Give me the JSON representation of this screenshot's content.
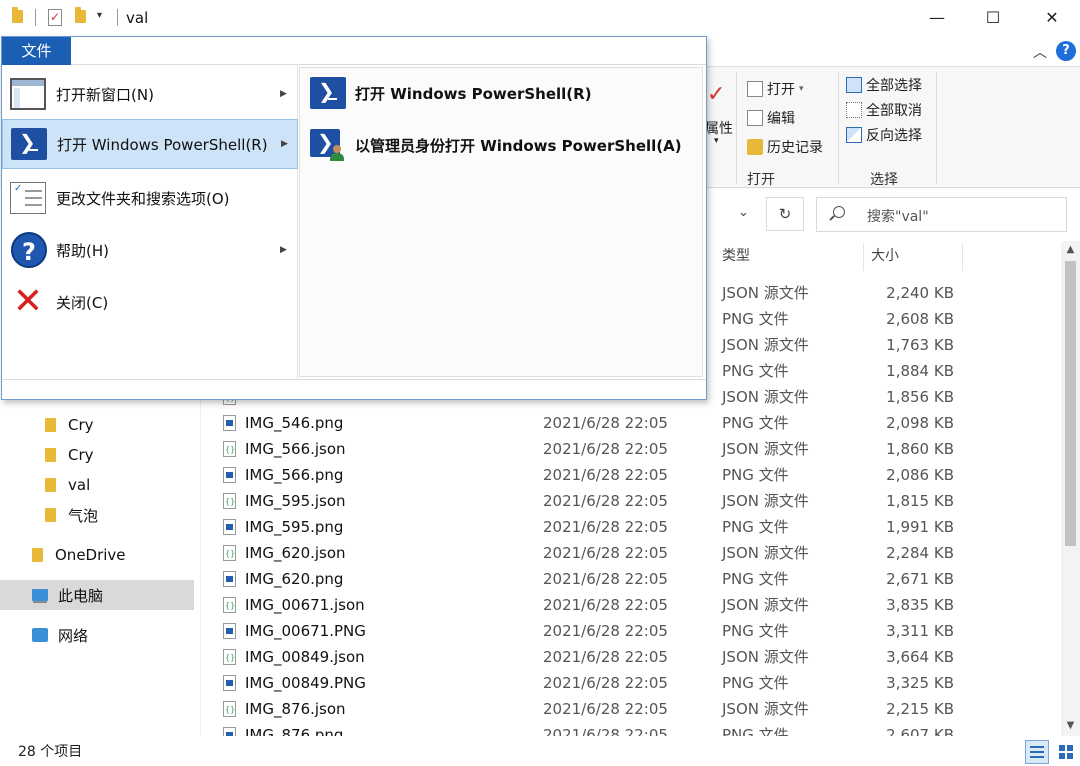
{
  "window": {
    "title": "val",
    "controls": {
      "minimize": "—",
      "maximize": "☐",
      "close": "✕"
    }
  },
  "ribbon": {
    "collapse_glyph": "︿",
    "help_glyph": "?",
    "partial_properties_label": "属性",
    "open_group": {
      "open_label": "打开",
      "open_arrow": "▾",
      "edit_label": "编辑",
      "history_label": "历史记录",
      "group_label": "打开"
    },
    "select_group": {
      "select_all_label": "全部选择",
      "select_none_label": "全部取消",
      "invert_label": "反向选择",
      "group_label": "选择"
    }
  },
  "address": {
    "dropdown_glyph": "⌄",
    "refresh_glyph": "↻",
    "search_placeholder": "搜索\"val\""
  },
  "file_menu": {
    "tab_label": "文件",
    "items": [
      {
        "label": "打开新窗口(N)",
        "has_submenu": true,
        "icon": "new-window-icon"
      },
      {
        "label": "打开 Windows PowerShell(R)",
        "has_submenu": true,
        "icon": "powershell-icon",
        "active": true
      },
      {
        "label": "更改文件夹和搜索选项(O)",
        "has_submenu": false,
        "icon": "folder-options-icon"
      },
      {
        "label": "帮助(H)",
        "has_submenu": true,
        "icon": "help-icon"
      },
      {
        "label": "关闭(C)",
        "has_submenu": false,
        "icon": "close-x-icon"
      }
    ],
    "submenu_arrow": "▶",
    "submenu": [
      {
        "label": "打开 Windows PowerShell(R)",
        "icon": "powershell-icon"
      },
      {
        "label": "以管理员身份打开 Windows PowerShell(A)",
        "icon": "powershell-admin-icon"
      }
    ]
  },
  "nav_pane": {
    "items": [
      {
        "label": "Cry",
        "icon": "folder-icon",
        "indent": true
      },
      {
        "label": "Cry",
        "icon": "folder-icon",
        "indent": true
      },
      {
        "label": "val",
        "icon": "folder-icon",
        "indent": true
      },
      {
        "label": "气泡",
        "icon": "folder-icon",
        "indent": true
      },
      {
        "label": "OneDrive",
        "icon": "folder-icon",
        "indent": false
      },
      {
        "label": "此电脑",
        "icon": "computer-icon",
        "indent": false,
        "selected": true
      },
      {
        "label": "网络",
        "icon": "network-icon",
        "indent": false
      }
    ]
  },
  "file_list": {
    "headers": {
      "type": "类型",
      "size": "大小"
    },
    "rows": [
      {
        "name": "",
        "date": "",
        "type": "JSON 源文件",
        "size": "2,240 KB",
        "kind": "json"
      },
      {
        "name": "",
        "date": "",
        "type": "PNG 文件",
        "size": "2,608 KB",
        "kind": "png"
      },
      {
        "name": "",
        "date": "",
        "type": "JSON 源文件",
        "size": "1,763 KB",
        "kind": "json"
      },
      {
        "name": "",
        "date": "",
        "type": "PNG 文件",
        "size": "1,884 KB",
        "kind": "png"
      },
      {
        "name": "",
        "date": "",
        "type": "JSON 源文件",
        "size": "1,856 KB",
        "kind": "json"
      },
      {
        "name": "IMG_546.png",
        "date": "2021/6/28 22:05",
        "type": "PNG 文件",
        "size": "2,098 KB",
        "kind": "png"
      },
      {
        "name": "IMG_566.json",
        "date": "2021/6/28 22:05",
        "type": "JSON 源文件",
        "size": "1,860 KB",
        "kind": "json"
      },
      {
        "name": "IMG_566.png",
        "date": "2021/6/28 22:05",
        "type": "PNG 文件",
        "size": "2,086 KB",
        "kind": "png"
      },
      {
        "name": "IMG_595.json",
        "date": "2021/6/28 22:05",
        "type": "JSON 源文件",
        "size": "1,815 KB",
        "kind": "json"
      },
      {
        "name": "IMG_595.png",
        "date": "2021/6/28 22:05",
        "type": "PNG 文件",
        "size": "1,991 KB",
        "kind": "png"
      },
      {
        "name": "IMG_620.json",
        "date": "2021/6/28 22:05",
        "type": "JSON 源文件",
        "size": "2,284 KB",
        "kind": "json"
      },
      {
        "name": "IMG_620.png",
        "date": "2021/6/28 22:05",
        "type": "PNG 文件",
        "size": "2,671 KB",
        "kind": "png"
      },
      {
        "name": "IMG_00671.json",
        "date": "2021/6/28 22:05",
        "type": "JSON 源文件",
        "size": "3,835 KB",
        "kind": "json"
      },
      {
        "name": "IMG_00671.PNG",
        "date": "2021/6/28 22:05",
        "type": "PNG 文件",
        "size": "3,311 KB",
        "kind": "png"
      },
      {
        "name": "IMG_00849.json",
        "date": "2021/6/28 22:05",
        "type": "JSON 源文件",
        "size": "3,664 KB",
        "kind": "json"
      },
      {
        "name": "IMG_00849.PNG",
        "date": "2021/6/28 22:05",
        "type": "PNG 文件",
        "size": "3,325 KB",
        "kind": "png"
      },
      {
        "name": "IMG_876.json",
        "date": "2021/6/28 22:05",
        "type": "JSON 源文件",
        "size": "2,215 KB",
        "kind": "json"
      },
      {
        "name": "IMG_876.png",
        "date": "2021/6/28 22:05",
        "type": "PNG 文件",
        "size": "2,607 KB",
        "kind": "png"
      }
    ]
  },
  "scrollbar": {
    "up": "▲",
    "down": "▼"
  },
  "status_bar": {
    "item_count": "28 个项目"
  }
}
